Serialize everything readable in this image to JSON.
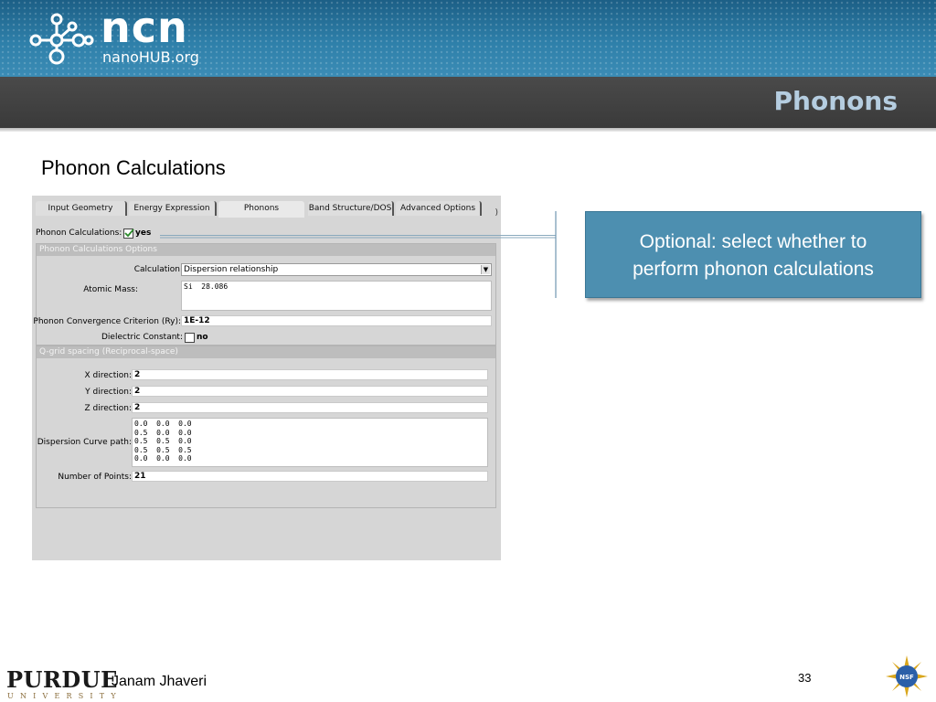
{
  "header": {
    "logo_main": "ncn",
    "logo_sub": "nanoHUB.org",
    "slide_title": "Phonons"
  },
  "subtitle": "Phonon Calculations",
  "app": {
    "tabs": [
      {
        "label": "Input Geometry",
        "active": false
      },
      {
        "label": "Energy Expression",
        "active": false
      },
      {
        "label": "Phonons",
        "active": true
      },
      {
        "label": "Band Structure/DOS",
        "active": false
      },
      {
        "label": "Advanced Options",
        "active": false
      }
    ],
    "phonon_calc": {
      "label": "Phonon Calculations:",
      "value": "yes",
      "checked": true
    },
    "options_group": {
      "title": "Phonon Calculations Options",
      "calculation": {
        "label": "Calculation:",
        "value": "Dispersion relationship"
      },
      "atomic_mass": {
        "label": "Atomic Mass:",
        "value": "Si  28.086"
      },
      "convergence": {
        "label": "Phonon Convergence Criterion (Ry):",
        "value": "1E-12"
      },
      "dielectric": {
        "label": "Dielectric Constant:",
        "value": "no",
        "checked": false
      }
    },
    "qgrid_group": {
      "title": "Q-grid spacing (Reciprocal-space)",
      "x": {
        "label": "X direction:",
        "value": "2"
      },
      "y": {
        "label": "Y direction:",
        "value": "2"
      },
      "z": {
        "label": "Z direction:",
        "value": "2"
      },
      "path": {
        "label": "Dispersion Curve path:",
        "value": "0.0  0.0  0.0\n0.5  0.0  0.0\n0.5  0.5  0.0\n0.5  0.5  0.5\n0.0  0.0  0.0"
      },
      "points": {
        "label": "Number of Points:",
        "value": "21"
      }
    }
  },
  "callout": {
    "line1": "Optional: select whether to",
    "line2": "perform phonon calculations"
  },
  "footer": {
    "university": "PURDUE",
    "university_sub": "UNIVERSITY",
    "author": "Janam Jhaveri",
    "page_number": "33"
  },
  "colors": {
    "header_blue": "#2e7fa9",
    "title_bar": "#3f3f3f",
    "title_text": "#b5cde0",
    "callout_bg": "#4d8fb0",
    "app_bg": "#d6d6d6"
  }
}
